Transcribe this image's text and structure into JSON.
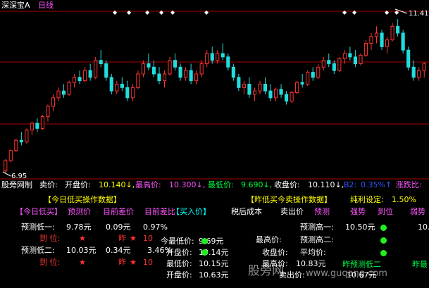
{
  "header": {
    "app_name": "深深宝A",
    "period": "日线",
    "high_marker": "11.41",
    "low_marker": "6.95",
    "star_symbol": "★"
  },
  "status_bar": {
    "brand": "股旁网制",
    "sell_label": "卖价:",
    "open_label": "开盘价:",
    "open_value": "10.140↓,",
    "high_label": "最高价:",
    "high_value": "10.300↓,",
    "low_label": "最低价:",
    "low_value": "9.690↓,",
    "close_label": "收盘价:",
    "close_value": "10.110↓,",
    "b2_label": "B2:",
    "b2_value": "0.35%↑",
    "change_label": "涨跌比:"
  },
  "panel": {
    "today_low_title": "【今日低买操作数据】",
    "yesterday_low_title": "【昨低买今卖操作数据】",
    "net_profit_label": "纯利设定:",
    "net_profit_value": "1.50%",
    "col_today_low_buy": "【今日低买】",
    "col_predict_price": "预测价",
    "col_gap": "目前差价",
    "col_gap_pct": "目前差比",
    "col_buy_price": "【买入价】",
    "col_cost": "税后成本",
    "col_sell_price": "卖出价",
    "col_predict_cut": "预测",
    "col_strong": "强势",
    "col_reach": "到位",
    "col_weak": "弱势",
    "low1_label": "预测低一:",
    "low1_price": "9.78元",
    "low1_gap": "0.09元",
    "low1_pct": "0.97%",
    "reach_label": "到  位:",
    "yesterday_label": "昨",
    "low1_yest_prefix": "10",
    "low2_label": "预测低二:",
    "low2_price": "10.03元",
    "low2_gap": "0.34元",
    "low2_pct": "3.46%",
    "low2_yest_prefix": "10",
    "today_low_price_label": "今最低价:",
    "today_low_price_value": "9.69元",
    "open_price_label": "开盘价:",
    "open_price_value": "10.14元",
    "low_price_label": "最低价:",
    "low_price_value": "10.15元",
    "open_price2_label": "开盘价:",
    "open_price2_value": "10.63元",
    "high1_label": "预测高一:",
    "high1_value": "10.50元",
    "high2_label": "预测高二:",
    "high_price_label": "最高价:",
    "high_price_value": "10.83元",
    "close_price_label": "收盘价:",
    "avg_label": "平均价:",
    "yest_pred_low2": "昨预测低二",
    "yest_low_label": "昨最",
    "right_value_1": "10.",
    "sell_price_label": "卖出价:",
    "sell_price_value": "10.67元",
    "watermark": "股旁网",
    "watermark_url": "www.guqang.com"
  },
  "chart_data": {
    "type": "candlestick",
    "title": "深深宝A 日线",
    "high_label": "11.41",
    "low_label": "6.95",
    "ylim": [
      6.8,
      11.6
    ],
    "colors": {
      "up": "#ff3333",
      "down": "#22dddd"
    },
    "candles": [
      [
        6.95,
        7.3,
        6.9,
        7.25
      ],
      [
        7.25,
        7.6,
        7.2,
        7.55
      ],
      [
        7.55,
        7.9,
        7.5,
        7.85
      ],
      [
        7.85,
        8.1,
        7.7,
        7.8
      ],
      [
        7.8,
        8.2,
        7.75,
        8.15
      ],
      [
        8.15,
        8.4,
        8.0,
        8.35
      ],
      [
        8.35,
        8.5,
        8.1,
        8.2
      ],
      [
        8.2,
        8.6,
        8.15,
        8.55
      ],
      [
        8.55,
        8.9,
        8.4,
        8.85
      ],
      [
        8.85,
        9.2,
        8.7,
        9.1
      ],
      [
        9.1,
        9.4,
        9.0,
        9.3
      ],
      [
        9.3,
        9.5,
        9.1,
        9.2
      ],
      [
        9.2,
        9.6,
        9.15,
        9.55
      ],
      [
        9.55,
        9.8,
        9.4,
        9.7
      ],
      [
        9.7,
        9.9,
        9.5,
        9.6
      ],
      [
        9.6,
        10.0,
        9.55,
        9.9
      ],
      [
        9.9,
        10.1,
        9.6,
        9.7
      ],
      [
        9.7,
        10.3,
        9.65,
        10.2
      ],
      [
        10.2,
        10.5,
        10.0,
        10.1
      ],
      [
        10.1,
        10.2,
        9.6,
        9.7
      ],
      [
        9.7,
        9.8,
        9.2,
        9.3
      ],
      [
        9.3,
        9.6,
        9.2,
        9.5
      ],
      [
        9.5,
        9.7,
        9.3,
        9.4
      ],
      [
        9.4,
        9.6,
        9.0,
        9.1
      ],
      [
        9.1,
        9.5,
        9.0,
        9.4
      ],
      [
        9.4,
        9.9,
        9.35,
        9.8
      ],
      [
        9.8,
        10.2,
        9.7,
        10.1
      ],
      [
        10.1,
        10.4,
        9.9,
        10.0
      ],
      [
        10.0,
        10.2,
        9.7,
        9.8
      ],
      [
        9.8,
        10.0,
        9.5,
        9.6
      ],
      [
        9.6,
        9.9,
        9.4,
        9.8
      ],
      [
        9.8,
        10.3,
        9.75,
        10.2
      ],
      [
        10.2,
        10.4,
        9.9,
        10.0
      ],
      [
        10.0,
        10.1,
        9.6,
        9.7
      ],
      [
        9.7,
        10.0,
        9.6,
        9.9
      ],
      [
        9.9,
        10.1,
        9.5,
        9.6
      ],
      [
        9.6,
        9.9,
        9.5,
        9.8
      ],
      [
        9.8,
        10.2,
        9.7,
        10.1
      ],
      [
        10.1,
        10.5,
        10.0,
        10.4
      ],
      [
        10.4,
        10.6,
        10.1,
        10.2
      ],
      [
        10.2,
        10.5,
        10.1,
        10.4
      ],
      [
        10.4,
        10.7,
        10.2,
        10.3
      ],
      [
        10.3,
        10.4,
        9.9,
        10.0
      ],
      [
        10.0,
        10.1,
        9.6,
        9.7
      ],
      [
        9.7,
        9.8,
        9.3,
        9.4
      ],
      [
        9.4,
        9.6,
        9.2,
        9.5
      ],
      [
        9.5,
        9.7,
        9.1,
        9.2
      ],
      [
        9.2,
        9.4,
        9.0,
        9.3
      ],
      [
        9.3,
        9.6,
        9.2,
        9.5
      ],
      [
        9.5,
        9.7,
        9.2,
        9.3
      ],
      [
        9.3,
        9.5,
        9.0,
        9.1
      ],
      [
        9.1,
        9.4,
        9.0,
        9.35
      ],
      [
        9.35,
        9.5,
        9.1,
        9.2
      ],
      [
        9.2,
        9.3,
        8.9,
        9.0
      ],
      [
        9.0,
        9.3,
        8.95,
        9.25
      ],
      [
        9.25,
        9.6,
        9.2,
        9.55
      ],
      [
        9.55,
        9.8,
        9.4,
        9.5
      ],
      [
        9.5,
        9.9,
        9.45,
        9.85
      ],
      [
        9.85,
        10.0,
        9.6,
        9.7
      ],
      [
        9.7,
        10.1,
        9.65,
        10.0
      ],
      [
        10.0,
        10.3,
        9.9,
        10.2
      ],
      [
        10.2,
        10.4,
        10.0,
        10.1
      ],
      [
        10.1,
        10.2,
        9.8,
        9.9
      ],
      [
        9.9,
        10.3,
        9.85,
        10.25
      ],
      [
        10.25,
        10.5,
        10.1,
        10.4
      ],
      [
        10.4,
        10.6,
        10.2,
        10.3
      ],
      [
        10.3,
        10.5,
        10.0,
        10.1
      ],
      [
        10.1,
        10.4,
        10.05,
        10.35
      ],
      [
        10.35,
        10.8,
        10.3,
        10.7
      ],
      [
        10.7,
        11.0,
        10.5,
        10.9
      ],
      [
        10.9,
        11.2,
        10.7,
        11.0
      ],
      [
        11.0,
        11.1,
        10.5,
        10.6
      ],
      [
        10.6,
        10.9,
        10.4,
        10.8
      ],
      [
        10.8,
        11.3,
        10.75,
        11.2
      ],
      [
        11.2,
        11.41,
        10.9,
        11.0
      ],
      [
        11.0,
        11.1,
        10.4,
        10.5
      ],
      [
        10.5,
        10.6,
        9.9,
        10.0
      ],
      [
        10.0,
        10.2,
        9.6,
        9.7
      ],
      [
        9.7,
        10.0,
        9.6,
        9.9
      ],
      [
        9.9,
        10.14,
        9.69,
        10.11
      ]
    ]
  }
}
